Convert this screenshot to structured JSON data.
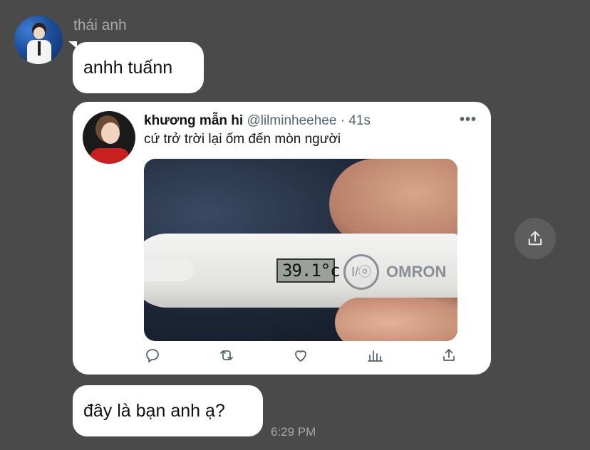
{
  "sender": {
    "name": "thái anh"
  },
  "messages": [
    {
      "text": "anhh tuấnn"
    },
    {
      "text": "đây là bạn anh ạ?"
    }
  ],
  "tweet": {
    "display_name": "khương mẫn hi",
    "handle": "@lilminheehee",
    "separator": "·",
    "time": "41s",
    "more_icon": "•••",
    "text": "cứ trở trời lại ốm đến mòn người",
    "photo": {
      "lcd_reading": "39.1°c",
      "power_label": "I/ⓞ",
      "brand": "OMRON"
    },
    "actions": [
      "reply-icon",
      "retweet-icon",
      "like-icon",
      "analytics-icon",
      "share-icon"
    ]
  },
  "share_button": {
    "icon": "share-icon"
  },
  "timestamp": "6:29 PM",
  "colors": {
    "background": "#4a4a4a",
    "bubble": "#ffffff",
    "muted_text": "#a8a8a8",
    "tweet_icon": "#536471"
  }
}
